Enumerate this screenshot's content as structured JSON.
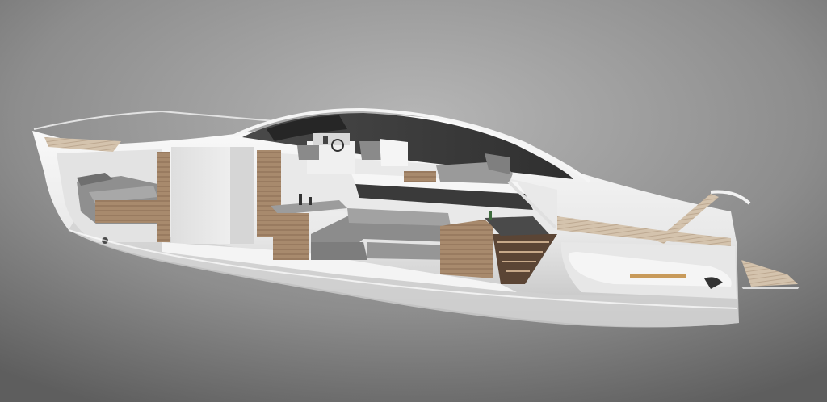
{
  "scene": {
    "subject": "yacht-cutaway-render",
    "colors": {
      "background_top": "#b4b4b4",
      "background_bottom": "#616161",
      "hull_white": "#f2f2f2",
      "hull_shadow": "#c9c9c9",
      "interior_wall": "#e6e6e6",
      "teak": "#a7876a",
      "teak_dark": "#7a5f47",
      "upholstery_grey": "#8e8e8e",
      "upholstery_dark": "#6f6f6f",
      "cabin_roof": "#3e3e3e",
      "glass": "#2c2c2c",
      "metal_rail": "#dcdcdc"
    }
  }
}
